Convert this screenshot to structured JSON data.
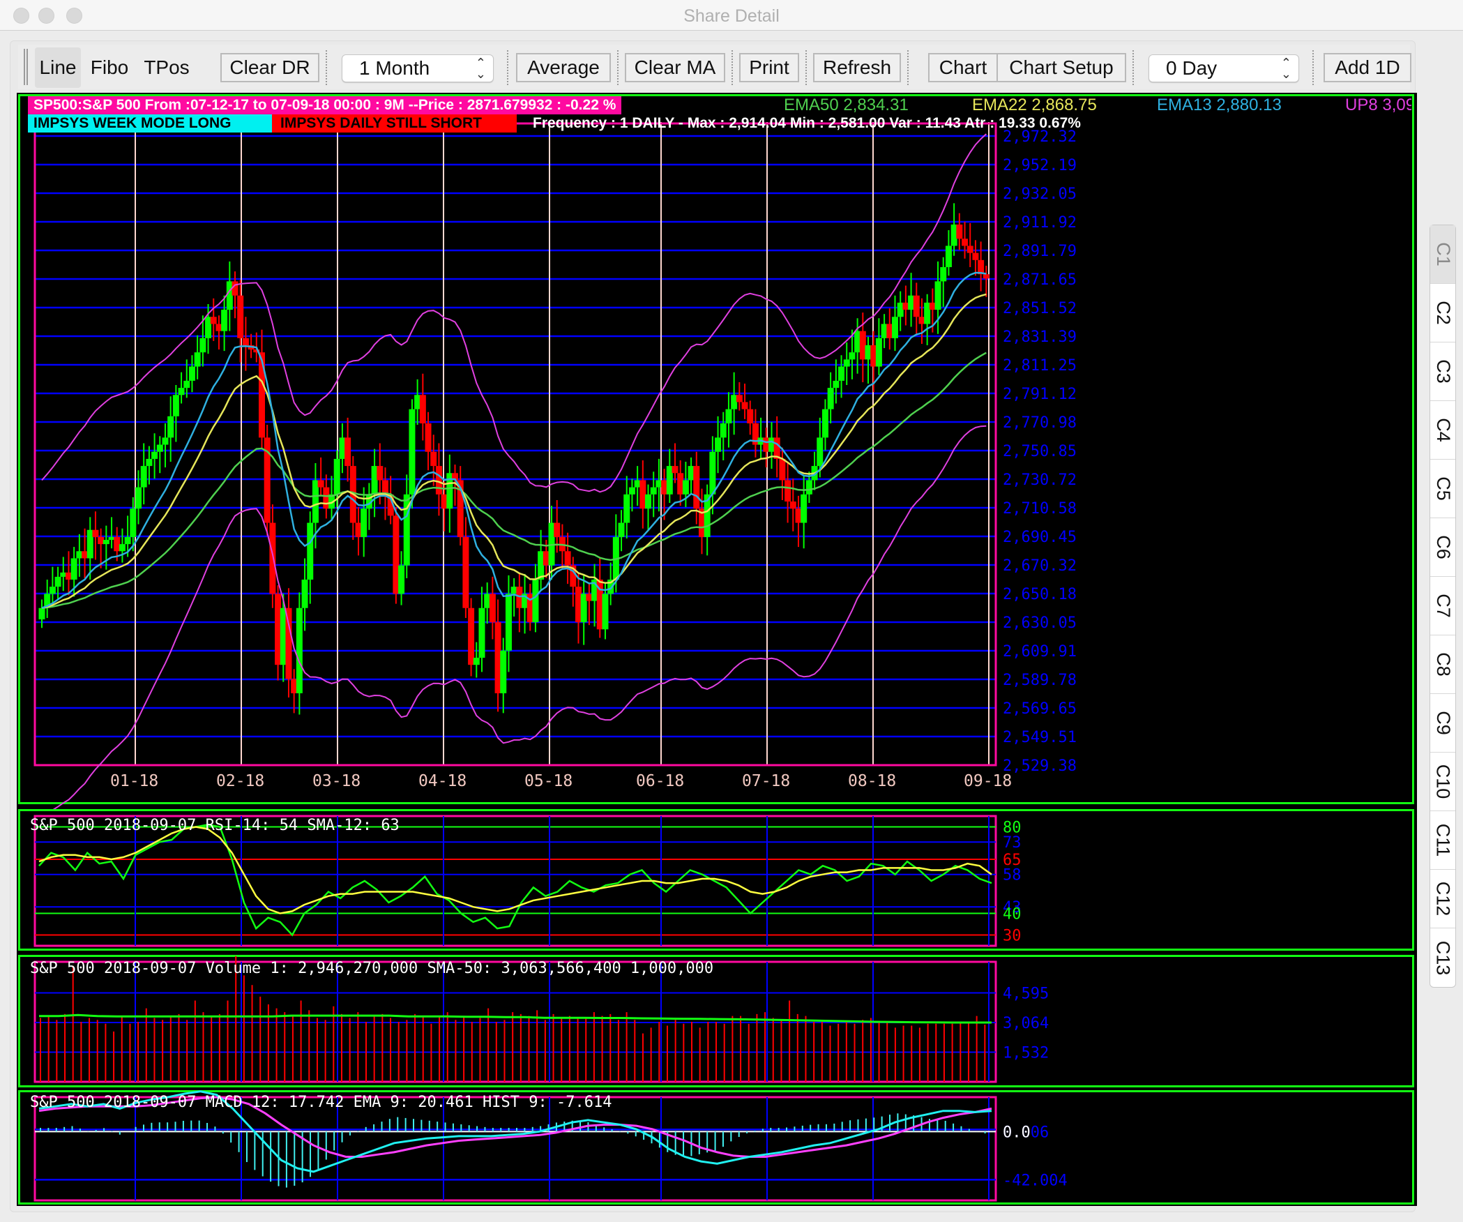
{
  "window": {
    "title": "Share Detail"
  },
  "toolbar": {
    "line_label": "Line",
    "fibo_label": "Fibo",
    "tpos_label": "TPos",
    "clear_dr_label": "Clear DR",
    "period_select": "1 Month",
    "average_label": "Average",
    "clear_ma_label": "Clear MA",
    "print_label": "Print",
    "refresh_label": "Refresh",
    "chart_label": "Chart",
    "chart_setup_label": "Chart Setup",
    "day_select": "0 Day",
    "add_1d_label": "Add 1D"
  },
  "side_tabs": [
    "C1",
    "C2",
    "C3",
    "C4",
    "C5",
    "C6",
    "C7",
    "C8",
    "C9",
    "C10",
    "C11",
    "C12",
    "C13"
  ],
  "active_side_tab": "C1",
  "price_panel": {
    "header_line1": "SP500:S&P 500 From :07-12-17 to 07-09-18 00:00 : 9M --Price : 2871.679932 : -0.22 %",
    "ema50": "EMA50 2,834.31",
    "ema22": "EMA22 2,868.75",
    "ema13": "EMA13 2,880.13",
    "up8": "UP8 3,09",
    "week_mode": "IMPSYS WEEK MODE LONG",
    "daily_mode": "IMPSYS DAILY STILL SHORT",
    "frequency": "Frequency : 1 DAILY - Max : 2,914.04 Min : 2,581.00 Var : 11.43 Atr : 19.33 0.67%"
  },
  "rsi_panel": {
    "title": "S&P 500 2018-09-07 RSI-14: 54 SMA-12: 63"
  },
  "volume_panel": {
    "title": "S&P 500 2018-09-07 Volume 1: 2,946,270,000 SMA-50: 3,063,566,400 1,000,000"
  },
  "macd_panel": {
    "title": "S&P 500 2018-09-07 MACD 12: 17.742 EMA 9: 20.461 HIST 9: -7.614"
  },
  "colors": {
    "up_candle": "#00ff00",
    "down_candle": "#ff0000",
    "ema50": "#4fd04f",
    "ema22": "#e6e65a",
    "ema13": "#2fb0e0",
    "bollinger": "#e040e0",
    "grid": "#0000ff",
    "panel_border": "#12ff12",
    "plot_border": "#ff0aa0"
  },
  "chart_data": [
    {
      "type": "candlestick",
      "title": "SP500:S&P 500 Daily",
      "ylim": [
        2529.38,
        2972.32
      ],
      "y_ticks": [
        "2,972.32",
        "2,952.19",
        "2,932.05",
        "2,911.92",
        "2,891.79",
        "2,871.65",
        "2,851.52",
        "2,831.39",
        "2,811.25",
        "2,791.12",
        "2,770.98",
        "2,750.85",
        "2,730.72",
        "2,710.58",
        "2,690.45",
        "2,670.32",
        "2,650.18",
        "2,630.05",
        "2,609.91",
        "2,589.78",
        "2,569.65",
        "2,549.51",
        "2,529.38"
      ],
      "x_ticks": [
        "01-18",
        "02-18",
        "03-18",
        "04-18",
        "05-18",
        "06-18",
        "07-18",
        "08-18",
        "09-18"
      ],
      "close": [
        2640,
        2650,
        2655,
        2662,
        2665,
        2660,
        2675,
        2680,
        2675,
        2695,
        2690,
        2685,
        2688,
        2690,
        2680,
        2685,
        2690,
        2710,
        2725,
        2740,
        2745,
        2750,
        2755,
        2760,
        2775,
        2790,
        2795,
        2800,
        2810,
        2820,
        2830,
        2845,
        2840,
        2835,
        2850,
        2870,
        2860,
        2830,
        2825,
        2822,
        2820,
        2760,
        2700,
        2650,
        2600,
        2640,
        2590,
        2580,
        2640,
        2660,
        2700,
        2730,
        2725,
        2710,
        2720,
        2745,
        2760,
        2740,
        2700,
        2690,
        2710,
        2720,
        2740,
        2730,
        2720,
        2705,
        2650,
        2670,
        2720,
        2780,
        2790,
        2770,
        2750,
        2740,
        2720,
        2710,
        2735,
        2730,
        2690,
        2640,
        2600,
        2605,
        2640,
        2650,
        2630,
        2580,
        2610,
        2650,
        2655,
        2640,
        2650,
        2630,
        2660,
        2680,
        2670,
        2700,
        2690,
        2680,
        2670,
        2655,
        2630,
        2650,
        2645,
        2660,
        2625,
        2650,
        2660,
        2690,
        2700,
        2720,
        2725,
        2730,
        2710,
        2720,
        2725,
        2730,
        2720,
        2740,
        2735,
        2720,
        2730,
        2740,
        2710,
        2690,
        2720,
        2750,
        2760,
        2770,
        2780,
        2790,
        2785,
        2780,
        2770,
        2755,
        2760,
        2750,
        2760,
        2745,
        2730,
        2715,
        2710,
        2700,
        2720,
        2730,
        2740,
        2760,
        2780,
        2795,
        2800,
        2810,
        2815,
        2820,
        2835,
        2815,
        2825,
        2810,
        2830,
        2840,
        2830,
        2845,
        2855,
        2850,
        2860,
        2845,
        2840,
        2855,
        2850,
        2870,
        2880,
        2895,
        2910,
        2900,
        2895,
        2890,
        2885,
        2875,
        2872
      ],
      "series": [
        {
          "name": "EMA13",
          "last": 2880.13
        },
        {
          "name": "EMA22",
          "last": 2868.75
        },
        {
          "name": "EMA50",
          "last": 2834.31
        }
      ],
      "stats": {
        "max": 2914.04,
        "min": 2581.0,
        "price": 2871.679932,
        "change_pct": -0.22
      }
    },
    {
      "type": "line",
      "title": "S&P 500 2018-09-07 RSI-14: 54 SMA-12: 63",
      "ylim": [
        30,
        80
      ],
      "y_ticks": [
        80,
        73,
        65,
        58,
        43,
        40,
        30
      ],
      "series": [
        {
          "name": "RSI-14",
          "last": 54,
          "values": [
            62,
            68,
            66,
            60,
            68,
            63,
            64,
            56,
            67,
            70,
            73,
            74,
            79,
            80,
            81,
            80,
            65,
            45,
            33,
            38,
            36,
            30,
            40,
            44,
            50,
            47,
            52,
            55,
            51,
            45,
            48,
            52,
            57,
            49,
            46,
            40,
            36,
            38,
            33,
            34,
            45,
            52,
            48,
            50,
            55,
            52,
            50,
            53,
            54,
            58,
            60,
            54,
            50,
            55,
            60,
            58,
            55,
            52,
            46,
            40,
            45,
            50,
            55,
            60,
            58,
            62,
            60,
            55,
            57,
            63,
            62,
            58,
            64,
            60,
            55,
            58,
            62,
            60,
            56,
            54
          ]
        },
        {
          "name": "SMA-12",
          "last": 63,
          "values": [
            64,
            66,
            67,
            67,
            66,
            66,
            65,
            66,
            68,
            71,
            74,
            77,
            79,
            80,
            79,
            75,
            68,
            58,
            48,
            42,
            40,
            41,
            44,
            46,
            48,
            49,
            49,
            50,
            50,
            50,
            50,
            50,
            49,
            48,
            47,
            45,
            43,
            42,
            41,
            42,
            44,
            46,
            47,
            48,
            49,
            50,
            51,
            52,
            53,
            54,
            55,
            55,
            54,
            54,
            55,
            56,
            56,
            55,
            53,
            50,
            49,
            50,
            52,
            55,
            57,
            58,
            59,
            59,
            60,
            60,
            61,
            61,
            61,
            61,
            60,
            60,
            61,
            63,
            62,
            58
          ]
        }
      ]
    },
    {
      "type": "bar",
      "title": "S&P 500 2018-09-07 Volume 1: 2,946,270,000 SMA-50: 3,063,566,400 1,000,000",
      "y_ticks": [
        "4,595",
        "3,064",
        "1,532"
      ],
      "unit": "millions",
      "last_volume": 2946.27,
      "last_sma50": 3063.5664,
      "values": [
        3300,
        3400,
        3200,
        3500,
        6000,
        3100,
        3300,
        3200,
        3000,
        2600,
        3400,
        3000,
        3100,
        3800,
        3300,
        3200,
        3400,
        3500,
        3200,
        4200,
        3600,
        3400,
        3500,
        4200,
        6500,
        5500,
        5000,
        4400,
        4000,
        3800,
        3600,
        3400,
        4200,
        3700,
        3300,
        3200,
        3900,
        3500,
        3300,
        3600,
        3100,
        3400,
        3500,
        3300,
        3100,
        3200,
        3500,
        3400,
        3000,
        3400,
        3600,
        3200,
        3400,
        3100,
        3300,
        3800,
        3100,
        3200,
        3600,
        3500,
        3400,
        3700,
        3200,
        3500,
        3300,
        3400,
        3300,
        3300,
        3600,
        3400,
        3500,
        3200,
        3600,
        3200,
        2500,
        2800,
        3100,
        2900,
        3200,
        3000,
        3100,
        2800,
        3100,
        3100,
        3000,
        3400,
        3400,
        3000,
        3500,
        3600,
        3300,
        3200,
        4200,
        3500,
        3400,
        3100,
        3100,
        2900,
        3000,
        3100,
        3000,
        3200,
        3300,
        3100,
        3100,
        2800,
        2900,
        2900,
        2800,
        3000,
        3000,
        3000,
        3000,
        3100,
        3100,
        3400,
        2950
      ],
      "sma50": [
        3400,
        3400,
        3450,
        3400,
        3380,
        3380,
        3380,
        3380,
        3380,
        3380,
        3380,
        3380,
        3380,
        3420,
        3420,
        3420,
        3420,
        3420,
        3420,
        3380,
        3380,
        3380,
        3360,
        3360,
        3340,
        3340,
        3310,
        3310,
        3310,
        3300,
        3300,
        3280,
        3270,
        3260,
        3250,
        3240,
        3230,
        3220,
        3200,
        3180,
        3160,
        3140,
        3120,
        3100,
        3090,
        3080,
        3070,
        3065,
        3064,
        3063
      ]
    },
    {
      "type": "bar+line",
      "title": "S&P 500 2018-09-07 MACD 12: 17.742 EMA 9: 20.461 HIST 9: -7.614",
      "y_ticks": [
        "0.006",
        "0.0",
        "-42.004"
      ],
      "ylim": [
        -60,
        30
      ],
      "series": [
        {
          "name": "MACD 12",
          "last": 17.742,
          "values": [
            20,
            22,
            24,
            22,
            24,
            20,
            25,
            28,
            30,
            33,
            35,
            32,
            20,
            5,
            -10,
            -25,
            -32,
            -35,
            -30,
            -25,
            -20,
            -15,
            -10,
            -8,
            -6,
            -5,
            -4,
            -4,
            -4,
            -3,
            -2,
            0,
            4,
            8,
            10,
            8,
            6,
            2,
            -5,
            -15,
            -22,
            -26,
            -28,
            -25,
            -22,
            -20,
            -18,
            -15,
            -12,
            -10,
            -6,
            -2,
            2,
            8,
            12,
            15,
            18,
            18,
            17,
            18
          ]
        },
        {
          "name": "EMA 9",
          "last": 20.461,
          "values": [
            18,
            20,
            21,
            22,
            22,
            22,
            22,
            23,
            25,
            27,
            29,
            30,
            28,
            24,
            16,
            6,
            -3,
            -12,
            -18,
            -22,
            -22,
            -20,
            -18,
            -15,
            -12,
            -10,
            -8,
            -7,
            -6,
            -5,
            -4,
            -3,
            -1,
            2,
            5,
            6,
            6,
            5,
            2,
            -3,
            -8,
            -14,
            -18,
            -21,
            -22,
            -22,
            -20,
            -18,
            -16,
            -14,
            -12,
            -9,
            -6,
            -2,
            3,
            8,
            12,
            15,
            17,
            20
          ]
        },
        {
          "name": "HIST 9",
          "last": -7.614
        }
      ]
    }
  ]
}
